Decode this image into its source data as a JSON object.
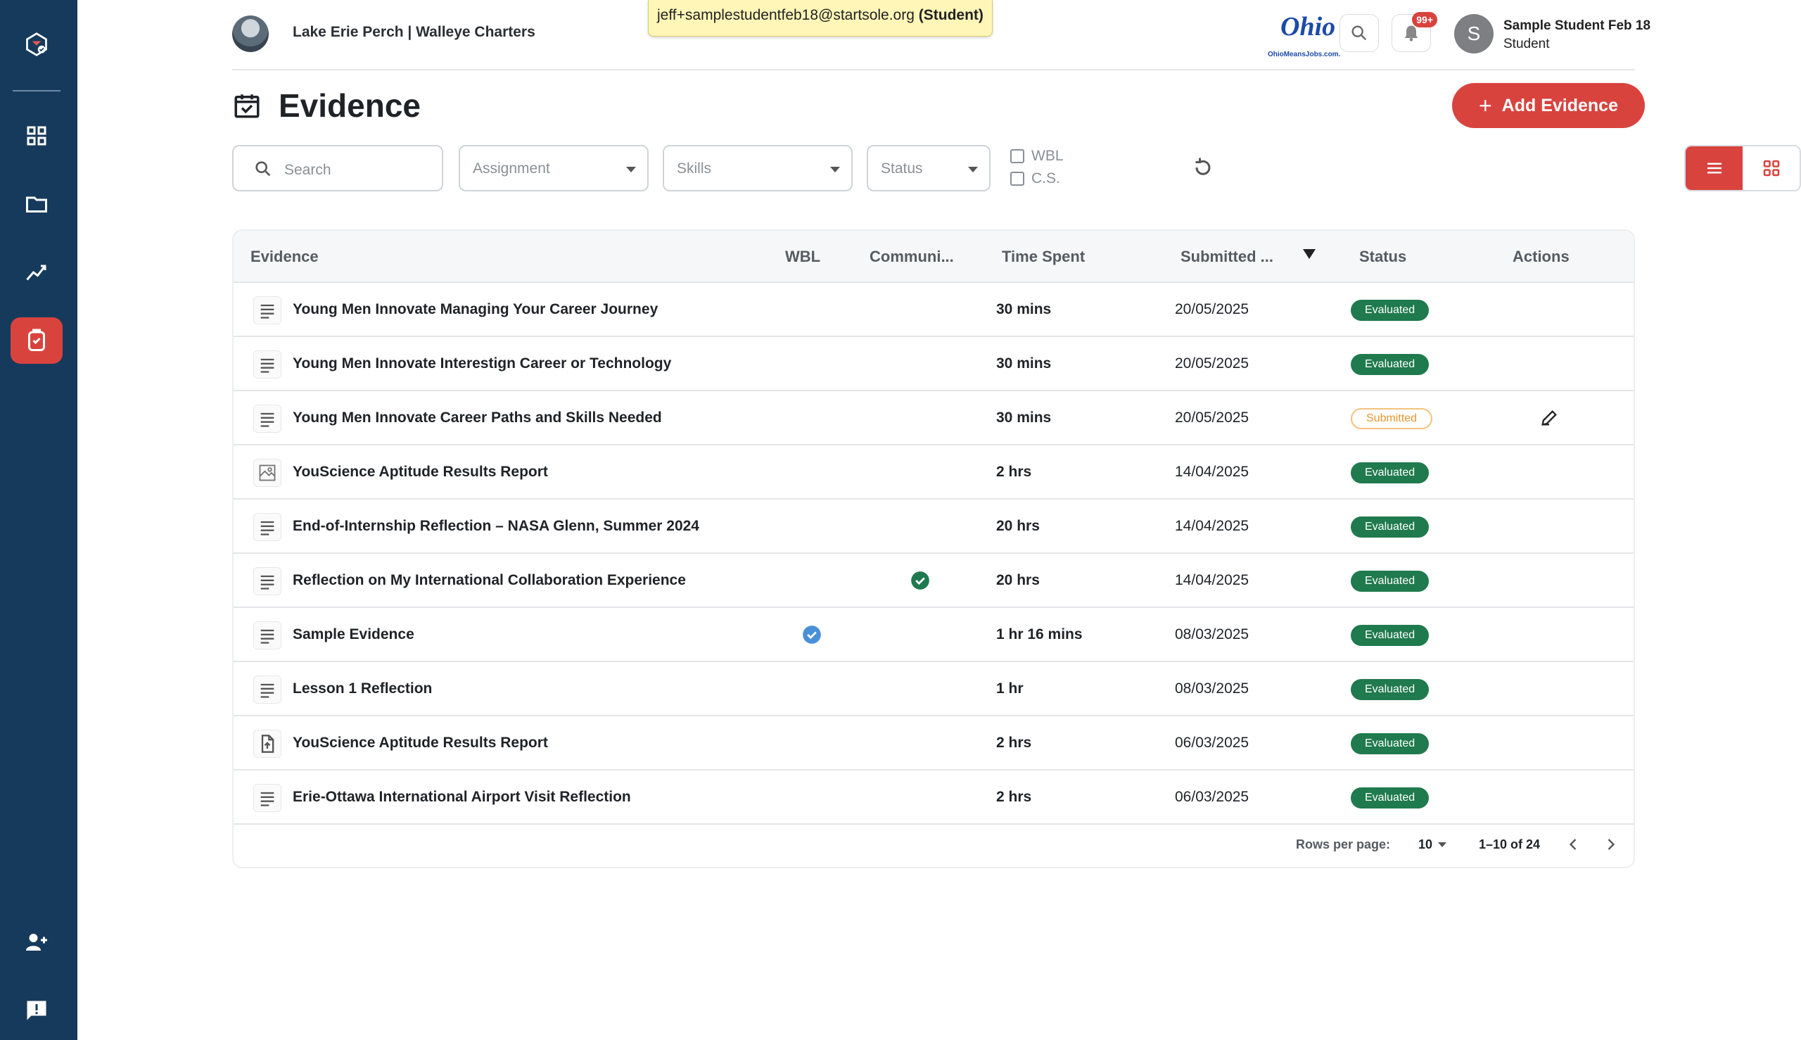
{
  "header": {
    "org_name": "Lake Erie Perch | Walleye Charters",
    "impersonation_email": "jeff+samplestudentfeb18@startsole.org",
    "impersonation_role": "(Student)",
    "logo_word": "Ohio",
    "logo_sub": "OhioMeansJobs.com.",
    "notification_count": "99+",
    "user_initial": "S",
    "user_name": "Sample Student Feb 18",
    "user_role": "Student"
  },
  "page": {
    "title": "Evidence",
    "add_button_label": "Add Evidence"
  },
  "filters": {
    "search_placeholder": "Search",
    "assignment_placeholder": "Assignment",
    "skills_placeholder": "Skills",
    "status_placeholder": "Status",
    "wbl_label": "WBL",
    "cs_label": "C.S."
  },
  "table": {
    "columns": [
      "Evidence",
      "WBL",
      "Communi...",
      "Time Spent",
      "Submitted ...",
      "Status",
      "Actions"
    ],
    "rows": [
      {
        "title": "Young Men Innovate Managing Your Career Journey",
        "icon": "text-lines-icon",
        "wbl": false,
        "cs": false,
        "time": "30 mins",
        "date": "20/05/2025",
        "status": "Evaluated",
        "editable": false
      },
      {
        "title": "Young Men Innovate Interestign Career or Technology",
        "icon": "text-lines-icon",
        "wbl": false,
        "cs": false,
        "time": "30 mins",
        "date": "20/05/2025",
        "status": "Evaluated",
        "editable": false
      },
      {
        "title": "Young Men Innovate Career Paths and Skills Needed",
        "icon": "text-lines-icon",
        "wbl": false,
        "cs": false,
        "time": "30 mins",
        "date": "20/05/2025",
        "status": "Submitted",
        "editable": true
      },
      {
        "title": "YouScience Aptitude Results Report",
        "icon": "image-icon",
        "wbl": false,
        "cs": false,
        "time": "2 hrs",
        "date": "14/04/2025",
        "status": "Evaluated",
        "editable": false
      },
      {
        "title": "End-of-Internship Reflection – NASA Glenn, Summer 2024",
        "icon": "text-lines-icon",
        "wbl": false,
        "cs": false,
        "time": "20 hrs",
        "date": "14/04/2025",
        "status": "Evaluated",
        "editable": false
      },
      {
        "title": "Reflection on My International Collaboration Experience",
        "icon": "text-lines-icon",
        "wbl": false,
        "cs": true,
        "time": "20 hrs",
        "date": "14/04/2025",
        "status": "Evaluated",
        "editable": false
      },
      {
        "title": "Sample Evidence",
        "icon": "text-lines-icon",
        "wbl": true,
        "cs": false,
        "time": "1 hr 16 mins",
        "date": "08/03/2025",
        "status": "Evaluated",
        "editable": false
      },
      {
        "title": "Lesson 1 Reflection",
        "icon": "text-lines-icon",
        "wbl": false,
        "cs": false,
        "time": "1 hr",
        "date": "08/03/2025",
        "status": "Evaluated",
        "editable": false
      },
      {
        "title": "YouScience Aptitude Results Report",
        "icon": "file-upload-icon",
        "wbl": false,
        "cs": false,
        "time": "2 hrs",
        "date": "06/03/2025",
        "status": "Evaluated",
        "editable": false
      },
      {
        "title": "Erie-Ottawa International Airport Visit Reflection",
        "icon": "text-lines-icon",
        "wbl": false,
        "cs": false,
        "time": "2 hrs",
        "date": "06/03/2025",
        "status": "Evaluated",
        "editable": false
      }
    ]
  },
  "pagination": {
    "rows_per_page_label": "Rows per page:",
    "rows_per_page": "10",
    "range": "1–10 of 24"
  },
  "colors": {
    "sidebar": "#163a5c",
    "accent": "#d8433e",
    "evaluated": "#1f7a4d",
    "submitted": "#e8962c",
    "wbl_check": "#4a90d9"
  }
}
